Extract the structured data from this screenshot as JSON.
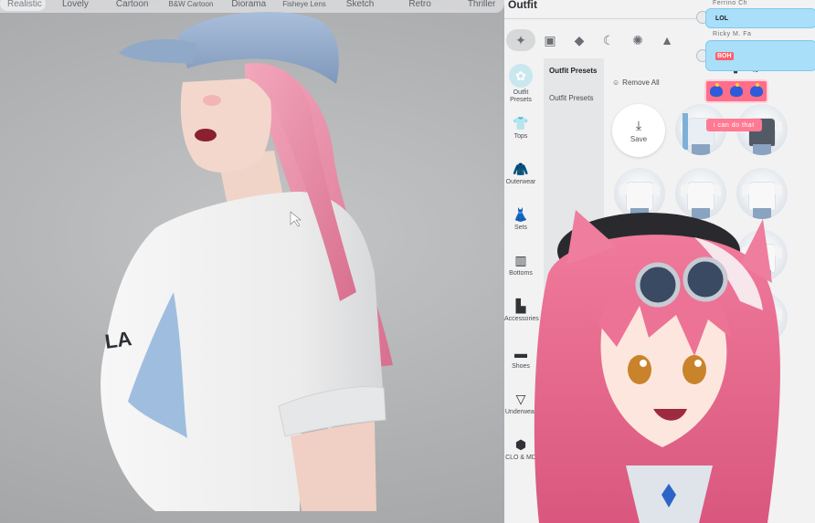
{
  "style_filters": [
    "Realistic",
    "Lovely",
    "Cartoon",
    "B&W Cartoon",
    "Diorama",
    "Fisheye Lens",
    "Sketch",
    "Retro",
    "Thriller"
  ],
  "active_filter": "Realistic",
  "panel": {
    "title": "Outfit",
    "tab_icons": [
      "sparkle-icon",
      "gift-icon",
      "graduation-cap-icon",
      "moon-icon",
      "firework-icon",
      "mountain-icon"
    ],
    "categories": [
      {
        "label": "Outfit Presets",
        "icon": "outfit-presets-icon",
        "active": true
      },
      {
        "label": "Tops",
        "icon": "tshirt-icon"
      },
      {
        "label": "Outerwear",
        "icon": "jacket-icon"
      },
      {
        "label": "Sets",
        "icon": "dress-icon"
      },
      {
        "label": "Bottoms",
        "icon": "pants-icon"
      },
      {
        "label": "Accessories",
        "icon": "sock-icon"
      },
      {
        "label": "Shoes",
        "icon": "shoe-icon"
      },
      {
        "label": "Underwear",
        "icon": "underwear-icon"
      },
      {
        "label": "CLO & MD",
        "icon": "cube-icon"
      }
    ],
    "subnav": [
      {
        "label": "Outfit Presets",
        "active": true
      },
      {
        "label": "Outfit Presets",
        "active": false
      }
    ],
    "remove_all": "Remove All",
    "save": "Save"
  },
  "chat": [
    {
      "user": "Ferrino Ch",
      "text": "LOL"
    },
    {
      "user": "Ricky M. Fa",
      "text": "BOH"
    }
  ],
  "stream_overlay": {
    "caption": "i can do that"
  },
  "colors": {
    "panel_bg": "#f2f2f3",
    "subnav_bg": "#e5e6e8",
    "chat_bubble": "#a9dff8",
    "overlay_pink": "#ff7a92",
    "hair_pink": "#e98aa6",
    "cap_blue": "#8ea8c9"
  }
}
